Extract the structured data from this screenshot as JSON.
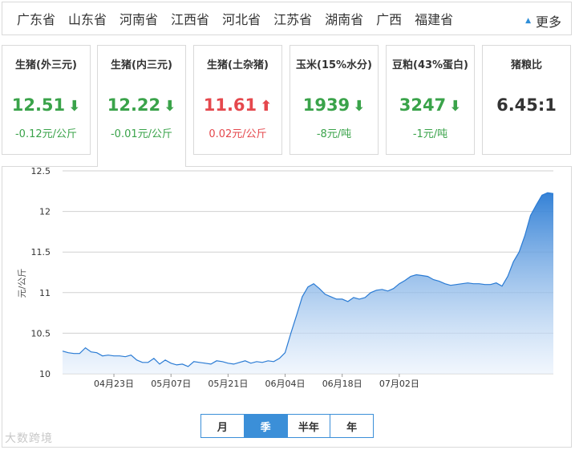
{
  "regions": [
    "广东省",
    "山东省",
    "河南省",
    "江西省",
    "河北省",
    "江苏省",
    "湖南省",
    "广西",
    "福建省"
  ],
  "more_label": "更多",
  "cards": [
    {
      "name": "生猪(外三元)",
      "price": "12.51",
      "change": "-0.12元/公斤",
      "trend": "down"
    },
    {
      "name": "生猪(内三元)",
      "price": "12.22",
      "change": "-0.01元/公斤",
      "trend": "down"
    },
    {
      "name": "生猪(土杂猪)",
      "price": "11.61",
      "change": "0.02元/公斤",
      "trend": "up"
    },
    {
      "name": "玉米(15%水分)",
      "price": "1939",
      "change": "-8元/吨",
      "trend": "down"
    },
    {
      "name": "豆粕(43%蛋白)",
      "price": "3247",
      "change": "-1元/吨",
      "trend": "down"
    },
    {
      "name": "猪粮比",
      "price": "6.45:1",
      "change": "",
      "trend": "none"
    }
  ],
  "active_card": 1,
  "range_buttons": [
    "月",
    "季",
    "半年",
    "年"
  ],
  "active_range": 1,
  "watermark": "大数跨境",
  "colors": {
    "accent": "#3b8fd8",
    "down": "#3aa34a",
    "up": "#e5484d",
    "line": "#2a7bd4"
  },
  "chart_data": {
    "type": "area",
    "title": "",
    "xlabel": "",
    "ylabel": "元/公斤",
    "ylim": [
      10,
      12.5
    ],
    "yticks": [
      "10",
      "10.5",
      "11",
      "11.5",
      "12",
      "12.5"
    ],
    "xticks": [
      {
        "label": "04月23日",
        "index": 9
      },
      {
        "label": "05月07日",
        "index": 19
      },
      {
        "label": "05月21日",
        "index": 29
      },
      {
        "label": "06月04日",
        "index": 39
      },
      {
        "label": "06月18日",
        "index": 49
      },
      {
        "label": "07月02日",
        "index": 59
      }
    ],
    "series": [
      {
        "values": [
          10.28,
          10.26,
          10.25,
          10.25,
          10.32,
          10.27,
          10.26,
          10.22,
          10.23,
          10.22,
          10.22,
          10.21,
          10.23,
          10.17,
          10.14,
          10.14,
          10.19,
          10.12,
          10.17,
          10.13,
          10.11,
          10.12,
          10.09,
          10.15,
          10.14,
          10.13,
          10.12,
          10.16,
          10.15,
          10.13,
          10.12,
          10.14,
          10.16,
          10.13,
          10.15,
          10.14,
          10.16,
          10.15,
          10.19,
          10.26,
          10.5,
          10.72,
          10.95,
          11.07,
          11.11,
          11.05,
          10.98,
          10.95,
          10.92,
          10.92,
          10.89,
          10.94,
          10.92,
          10.94,
          11.0,
          11.03,
          11.04,
          11.02,
          11.05,
          11.11,
          11.15,
          11.2,
          11.22,
          11.21,
          11.2,
          11.16,
          11.14,
          11.11,
          11.09,
          11.1,
          11.11,
          11.12,
          11.11,
          11.11,
          11.1,
          11.1,
          11.12,
          11.08,
          11.2,
          11.38,
          11.5,
          11.7,
          11.95,
          12.08,
          12.2,
          12.23,
          12.22
        ]
      }
    ]
  }
}
